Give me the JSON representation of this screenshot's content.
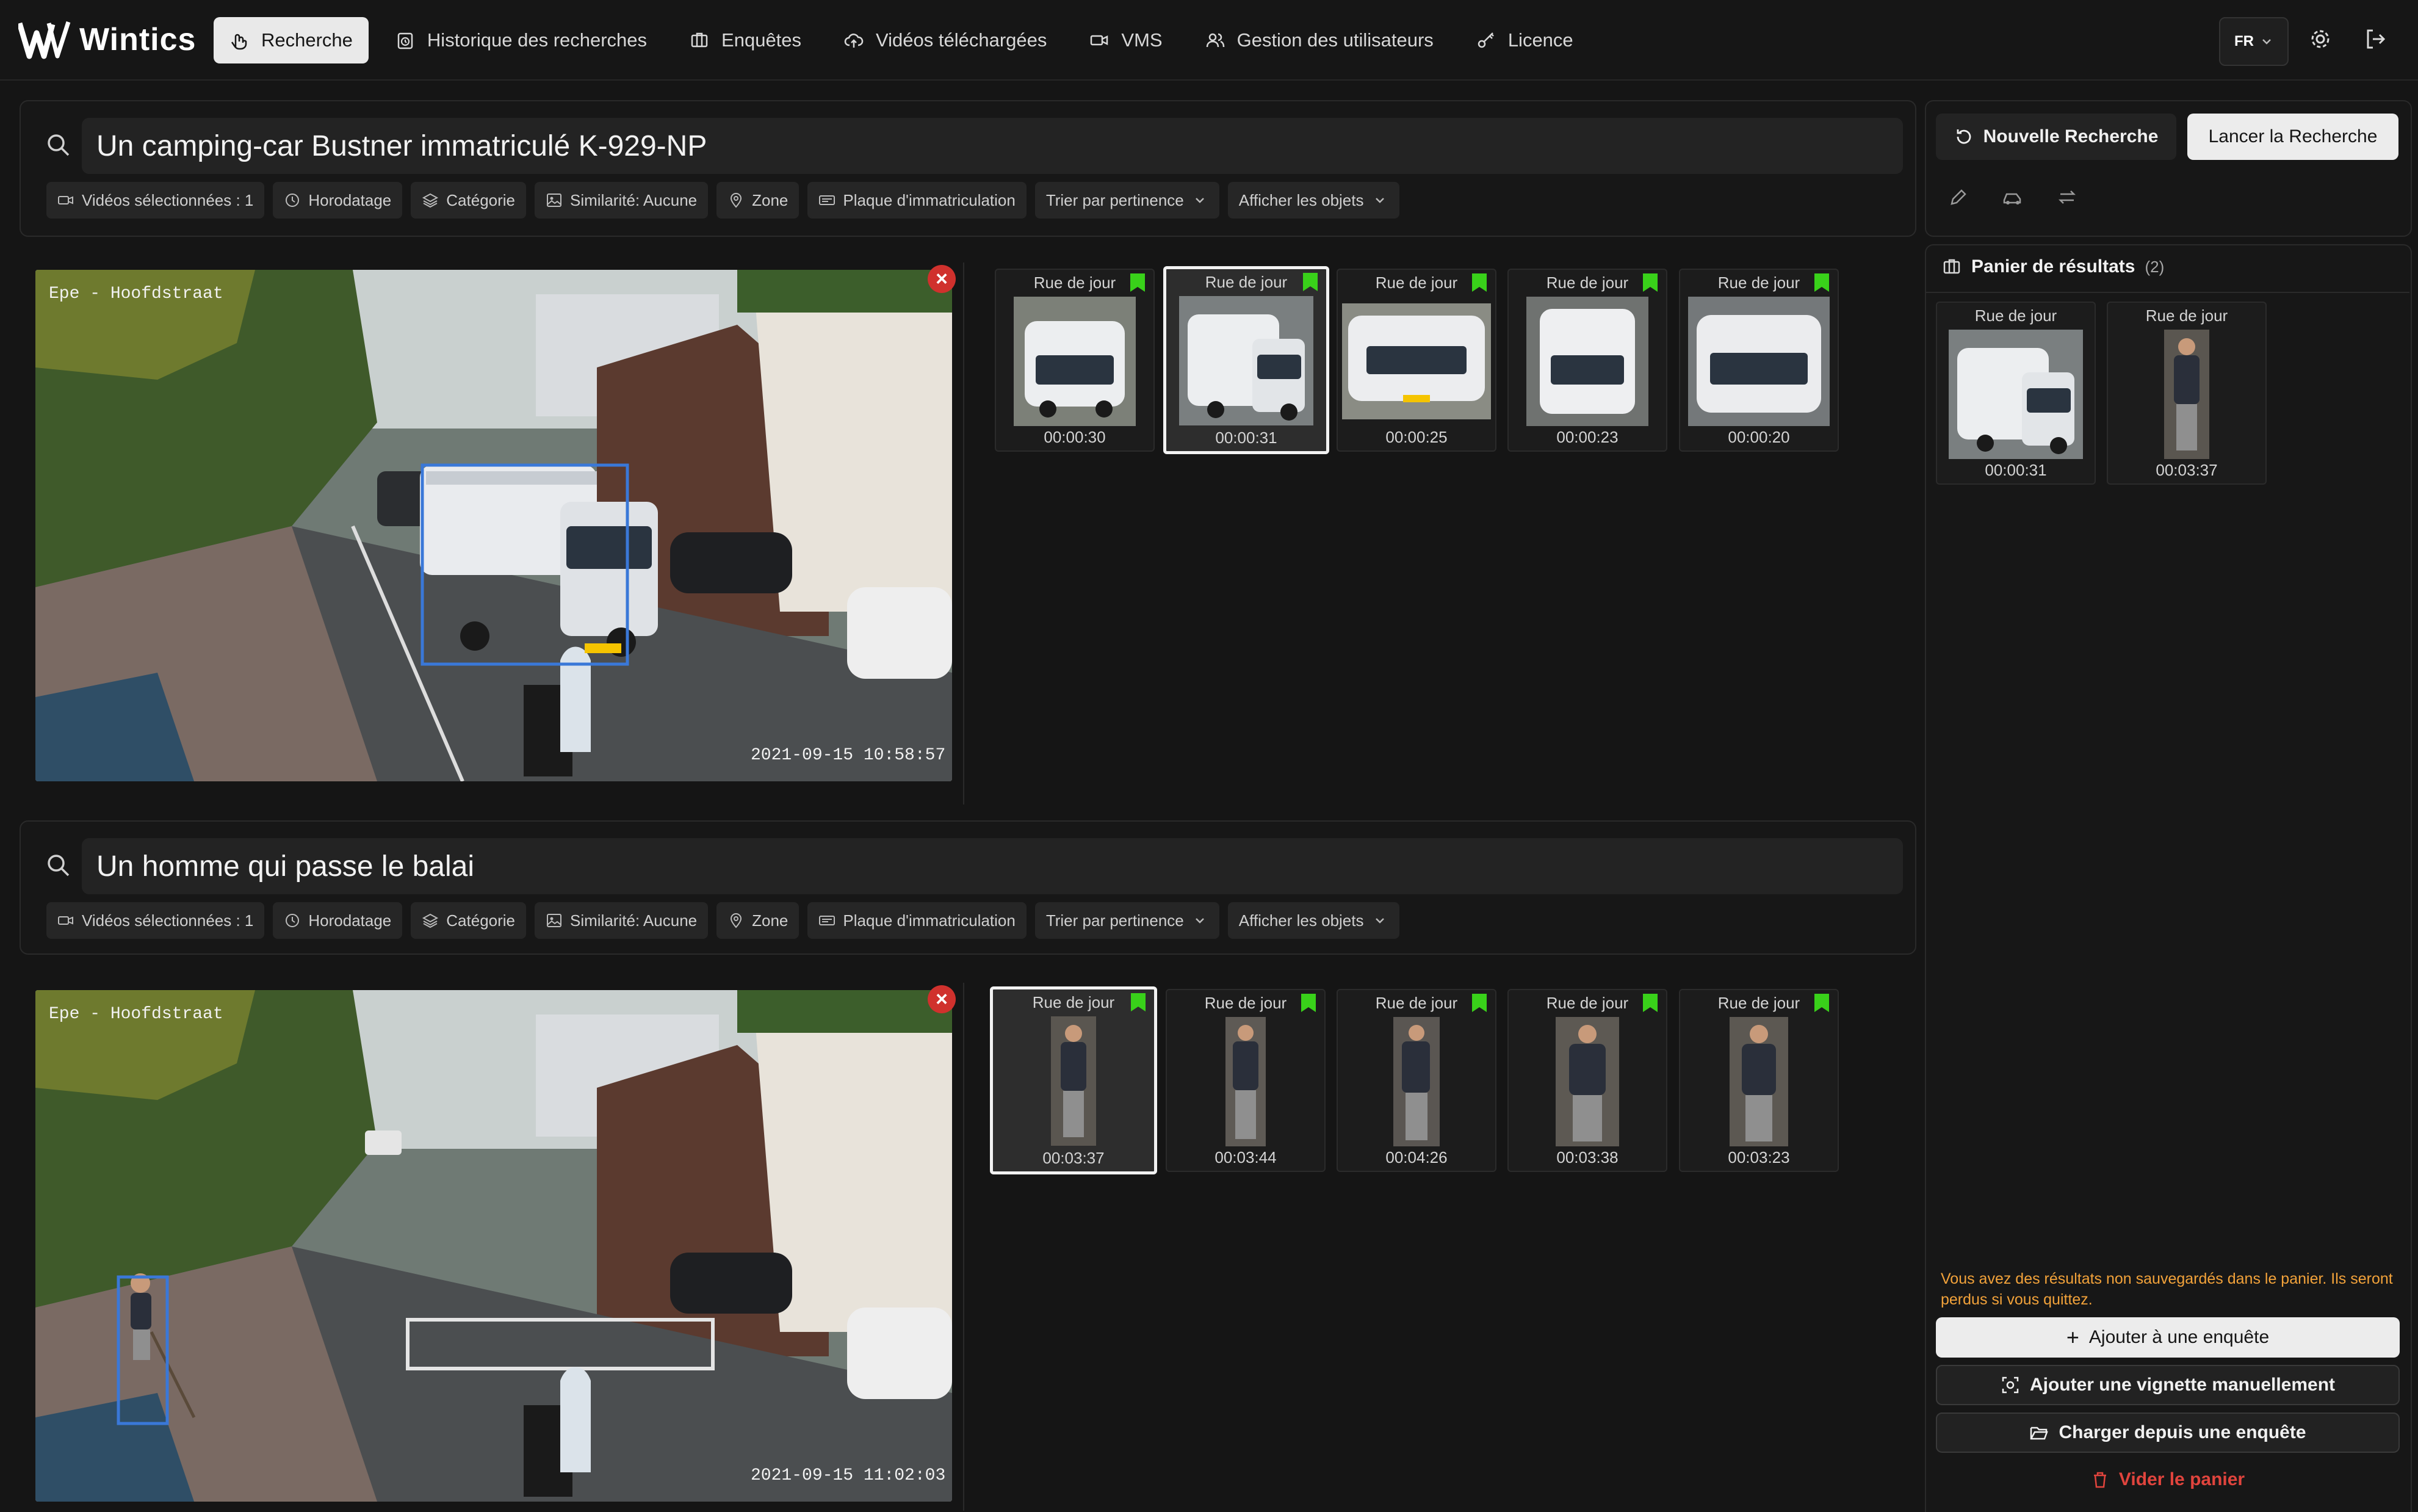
{
  "app": {
    "name": "Wintics",
    "language": "FR"
  },
  "nav": {
    "items": [
      {
        "label": "Recherche",
        "icon": "search-hand-icon",
        "active": true
      },
      {
        "label": "Historique des recherches",
        "icon": "history-icon"
      },
      {
        "label": "Enquêtes",
        "icon": "briefcase-icon"
      },
      {
        "label": "Vidéos téléchargées",
        "icon": "cloud-upload-icon"
      },
      {
        "label": "VMS",
        "icon": "video-camera-icon"
      },
      {
        "label": "Gestion des utilisateurs",
        "icon": "users-icon"
      },
      {
        "label": "Licence",
        "icon": "key-icon"
      }
    ]
  },
  "searches": [
    {
      "query": "Un camping-car Bustner immatriculé K-929-NP",
      "chips": [
        "Vidéos sélectionnées : 1",
        "Horodatage",
        "Catégorie",
        "Similarité: Aucune",
        "Zone",
        "Plaque d'immatriculation",
        "Trier par pertinence",
        "Afficher les objets"
      ],
      "frame": {
        "camera_label": "Epe - Hoofdstraat",
        "timestamp": "2021-09-15 10:58:57"
      },
      "results": [
        {
          "label": "Rue de jour",
          "time": "00:00:30",
          "selected": false
        },
        {
          "label": "Rue de jour",
          "time": "00:00:31",
          "selected": true
        },
        {
          "label": "Rue de jour",
          "time": "00:00:25",
          "selected": false
        },
        {
          "label": "Rue de jour",
          "time": "00:00:23",
          "selected": false
        },
        {
          "label": "Rue de jour",
          "time": "00:00:20",
          "selected": false
        }
      ]
    },
    {
      "query": "Un homme qui passe le balai",
      "chips": [
        "Vidéos sélectionnées : 1",
        "Horodatage",
        "Catégorie",
        "Similarité: Aucune",
        "Zone",
        "Plaque d'immatriculation",
        "Trier par pertinence",
        "Afficher les objets"
      ],
      "frame": {
        "camera_label": "Epe - Hoofdstraat",
        "timestamp": "2021-09-15 11:02:03"
      },
      "results": [
        {
          "label": "Rue de jour",
          "time": "00:03:37",
          "selected": true
        },
        {
          "label": "Rue de jour",
          "time": "00:03:44",
          "selected": false
        },
        {
          "label": "Rue de jour",
          "time": "00:04:26",
          "selected": false
        },
        {
          "label": "Rue de jour",
          "time": "00:03:38",
          "selected": false
        },
        {
          "label": "Rue de jour",
          "time": "00:03:23",
          "selected": false
        }
      ]
    }
  ],
  "actions": {
    "new_search": "Nouvelle Recherche",
    "run_search": "Lancer la Recherche"
  },
  "basket": {
    "title": "Panier de résultats",
    "count": "(2)",
    "items": [
      {
        "label": "Rue de jour",
        "time": "00:00:31",
        "kind": "camper-van"
      },
      {
        "label": "Rue de jour",
        "time": "00:03:37",
        "kind": "person"
      }
    ],
    "warning": "Vous avez des résultats non sauvegardés dans le panier. Ils seront perdus si vous quittez.",
    "add_to_case": "Ajouter à une enquête",
    "add_thumbnail": "Ajouter une vignette manuellement",
    "load_from_case": "Charger depuis une enquête",
    "empty_basket": "Vider le panier"
  },
  "colors": {
    "accent_box": "#3a78d8",
    "bookmark": "#39d11a",
    "danger": "#e0443d",
    "warning": "#f2a23a"
  }
}
